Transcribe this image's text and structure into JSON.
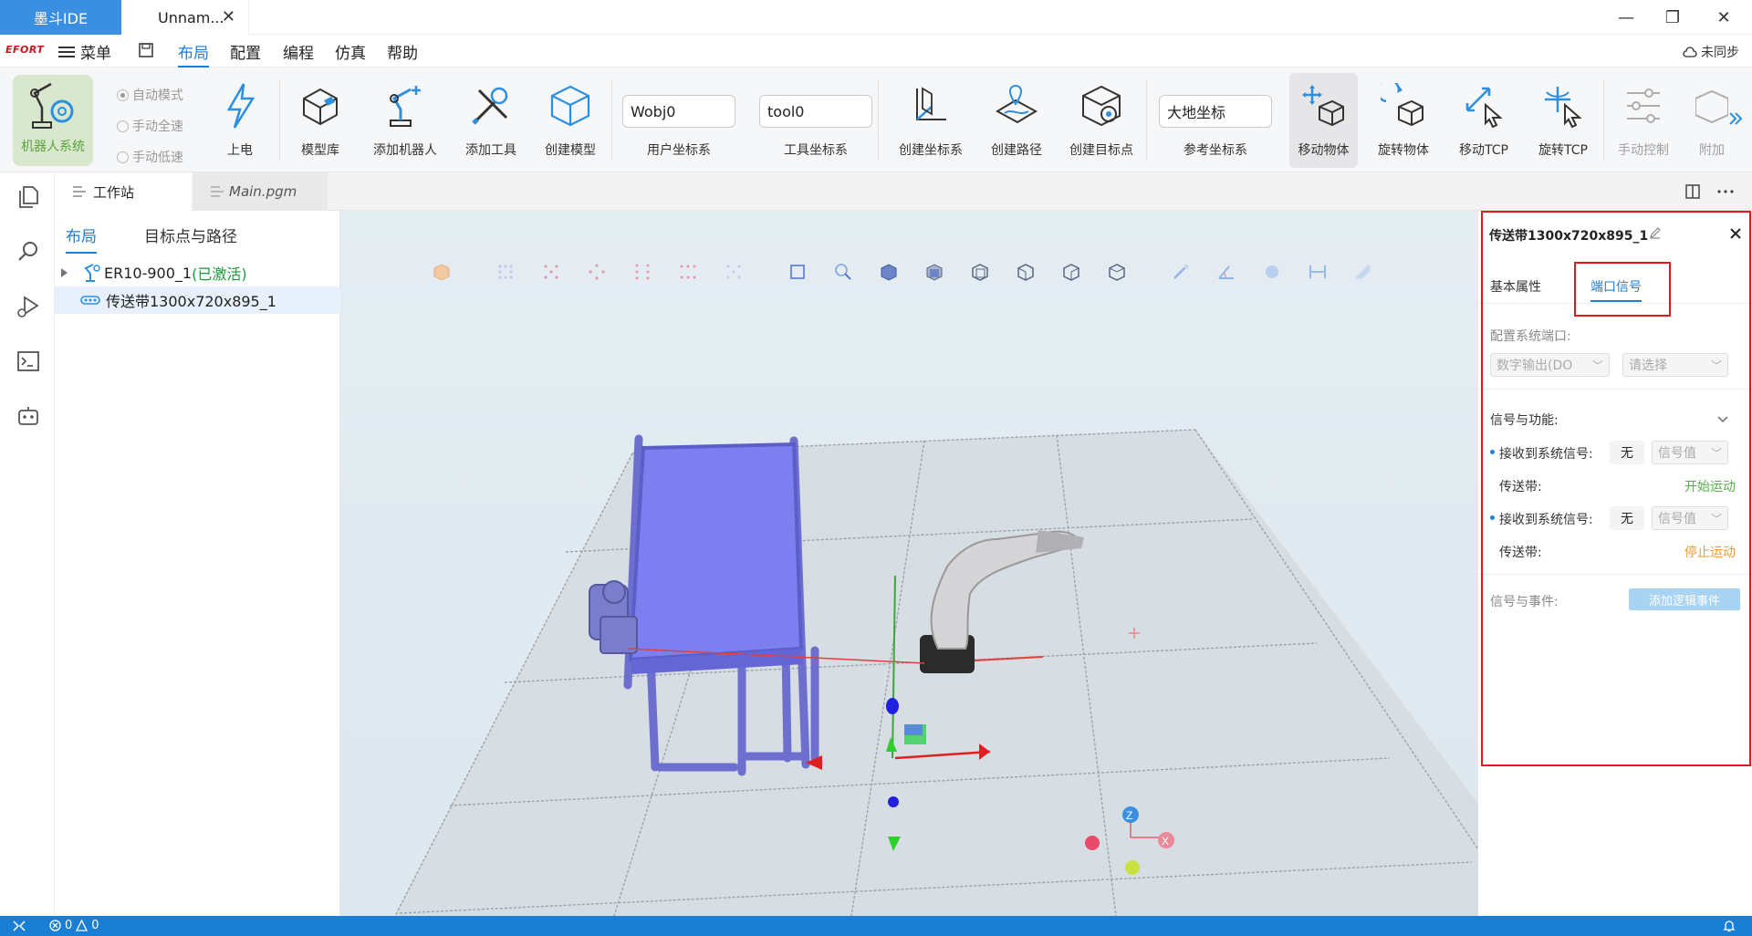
{
  "app": {
    "brand": "墨斗IDE",
    "file_tab": "Unnam...",
    "close": "✕"
  },
  "window": {
    "minimize": "—",
    "restore": "❐",
    "close": "✕"
  },
  "menubar": {
    "logo": "EFORT",
    "menu_label": "菜单",
    "items": [
      "布局",
      "配置",
      "编程",
      "仿真",
      "帮助"
    ],
    "active": "布局",
    "sync": "未同步"
  },
  "ribbon": {
    "robot_system": "机器人系统",
    "modes": [
      "自动模式",
      "手动全速",
      "手动低速"
    ],
    "power": "上电",
    "model_lib": "模型库",
    "add_robot": "添加机器人",
    "add_tool": "添加工具",
    "create_model": "创建模型",
    "user_frame_value": "Wobj0",
    "user_frame_label": "用户坐标系",
    "tool_frame_value": "tool0",
    "tool_frame_label": "工具坐标系",
    "create_frame": "创建坐标系",
    "create_path": "创建路径",
    "create_target": "创建目标点",
    "ref_frame_value": "大地坐标",
    "ref_frame_label": "参考坐标系",
    "move_object": "移动物体",
    "rotate_object": "旋转物体",
    "move_tcp": "移动TCP",
    "rotate_tcp": "旋转TCP",
    "jog": "手动控制",
    "attach": "附加"
  },
  "editor_tabs": [
    {
      "label": "工作站"
    },
    {
      "label": "Main.pgm"
    }
  ],
  "tree": {
    "subtabs": [
      "布局",
      "目标点与路径"
    ],
    "robot_name": "ER10-900_1",
    "robot_status": "(已激活)",
    "conveyor": "传送带1300x720x895_1"
  },
  "props": {
    "title": "传送带1300x720x895_1",
    "tabs": [
      "基本属性",
      "端口信号"
    ],
    "config_port_label": "配置系统端口:",
    "port_type": "数字输出(DO",
    "port_select": "请选择",
    "signal_func_label": "信号与功能:",
    "recv_label": "接收到系统信号:",
    "none": "无",
    "signal_value": "信号值",
    "conveyor_label": "传送带:",
    "start_motion": "开始运动",
    "stop_motion": "停止运动",
    "signal_event_label": "信号与事件:",
    "add_event": "添加逻辑事件"
  },
  "statusbar": {
    "errors": "0",
    "warnings": "0"
  },
  "axes": {
    "z": "Z",
    "x": "X"
  }
}
